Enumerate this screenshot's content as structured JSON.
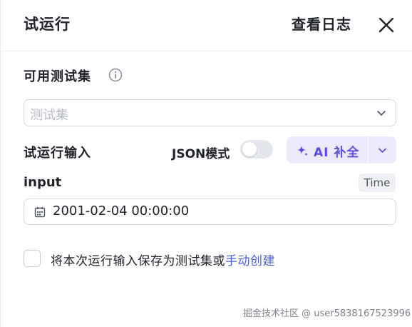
{
  "header": {
    "title": "试运行",
    "view_log_label": "查看日志"
  },
  "test_set": {
    "label": "可用测试集",
    "select_placeholder": "测试集"
  },
  "run_input": {
    "label": "试运行输入",
    "json_mode_label": "JSON模式",
    "json_mode_on": false,
    "ai_fill_label": "AI 补全"
  },
  "field": {
    "name": "input",
    "type_badge": "Time",
    "value": "2001-02-04 00:00:00"
  },
  "save_option": {
    "checked": false,
    "text": "将本次运行输入保存为测试集或",
    "link_text": "手动创建"
  },
  "watermark": "掘金技术社区 @ user5838167523996",
  "colors": {
    "accent": "#5a4de6",
    "link": "#4a5fd6",
    "ai_button_bg": "#eceafd",
    "border": "#d5d8de"
  }
}
